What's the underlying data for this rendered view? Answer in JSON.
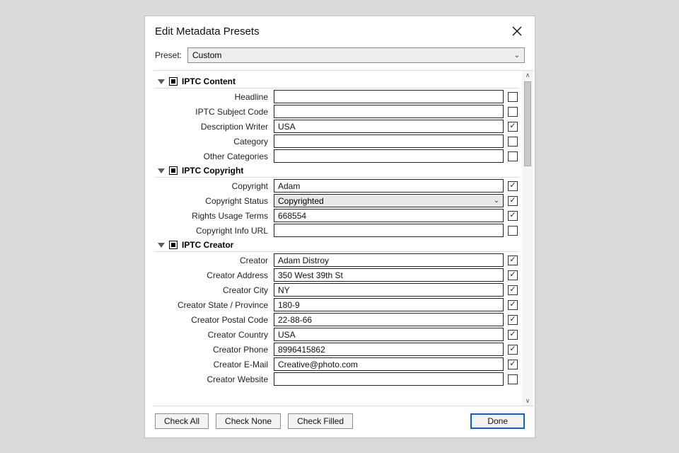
{
  "dialog": {
    "title": "Edit Metadata Presets",
    "preset_label": "Preset:",
    "preset_value": "Custom"
  },
  "sections": {
    "content": {
      "title": "IPTC Content",
      "fields": {
        "headline": {
          "label": "Headline",
          "value": "",
          "checked": false
        },
        "subject_code": {
          "label": "IPTC Subject Code",
          "value": "",
          "checked": false
        },
        "description_writer": {
          "label": "Description Writer",
          "value": "USA",
          "checked": true
        },
        "category": {
          "label": "Category",
          "value": "",
          "checked": false
        },
        "other_categories": {
          "label": "Other Categories",
          "value": "",
          "checked": false
        }
      }
    },
    "copyright": {
      "title": "IPTC Copyright",
      "fields": {
        "copyright": {
          "label": "Copyright",
          "value": "Adam",
          "checked": true
        },
        "copyright_status": {
          "label": "Copyright Status",
          "value": "Copyrighted",
          "checked": true
        },
        "rights_usage": {
          "label": "Rights Usage Terms",
          "value": "668554",
          "checked": true
        },
        "info_url": {
          "label": "Copyright Info URL",
          "value": "",
          "checked": false
        }
      }
    },
    "creator": {
      "title": "IPTC Creator",
      "fields": {
        "creator": {
          "label": "Creator",
          "value": "Adam Distroy",
          "checked": true
        },
        "address": {
          "label": "Creator Address",
          "value": "350 West 39th St",
          "checked": true
        },
        "city": {
          "label": "Creator City",
          "value": "NY",
          "checked": true
        },
        "state": {
          "label": "Creator State / Province",
          "value": "180-9",
          "checked": true
        },
        "postal": {
          "label": "Creator Postal Code",
          "value": "22-88-66",
          "checked": true
        },
        "country": {
          "label": "Creator Country",
          "value": "USA",
          "checked": true
        },
        "phone": {
          "label": "Creator Phone",
          "value": "8996415862",
          "checked": true
        },
        "email": {
          "label": "Creator E-Mail",
          "value": "Creative@photo.com",
          "checked": true
        },
        "website": {
          "label": "Creator Website",
          "value": "",
          "checked": false
        }
      }
    }
  },
  "footer": {
    "check_all": "Check All",
    "check_none": "Check None",
    "check_filled": "Check Filled",
    "done": "Done"
  }
}
